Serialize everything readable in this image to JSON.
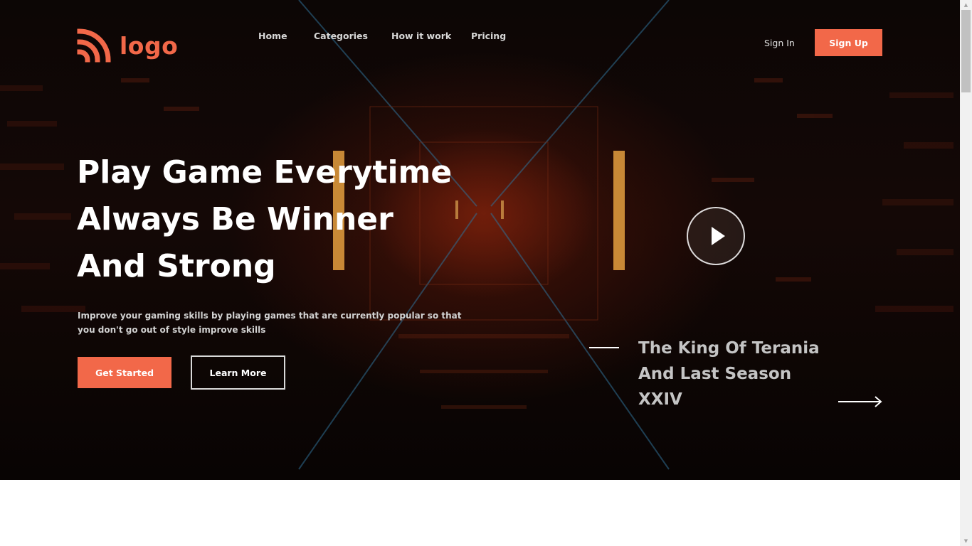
{
  "header": {
    "logo_text": "logo",
    "nav": [
      "Home",
      "Categories",
      "How it work",
      "Pricing"
    ],
    "sign_in": "Sign In",
    "sign_up": "Sign Up"
  },
  "hero": {
    "headline": [
      "Play Game Everytime",
      "Always Be Winner",
      "And Strong"
    ],
    "description": "Improve your gaming skills by playing games that are currently popular so that you don't go out of style improve skills",
    "primary_button": "Get Started",
    "secondary_button": "Learn More"
  },
  "feature": {
    "title": [
      "The King Of Terania",
      "And Last Season",
      "XXIV"
    ]
  },
  "icons": {
    "logo": "rss-style-arcs-icon",
    "play": "play-icon",
    "next": "arrow-right-icon"
  },
  "colors": {
    "accent": "#f26849",
    "text_white": "#ffffff",
    "hero_background": "#0c0605",
    "page_background": "#ffffff"
  }
}
